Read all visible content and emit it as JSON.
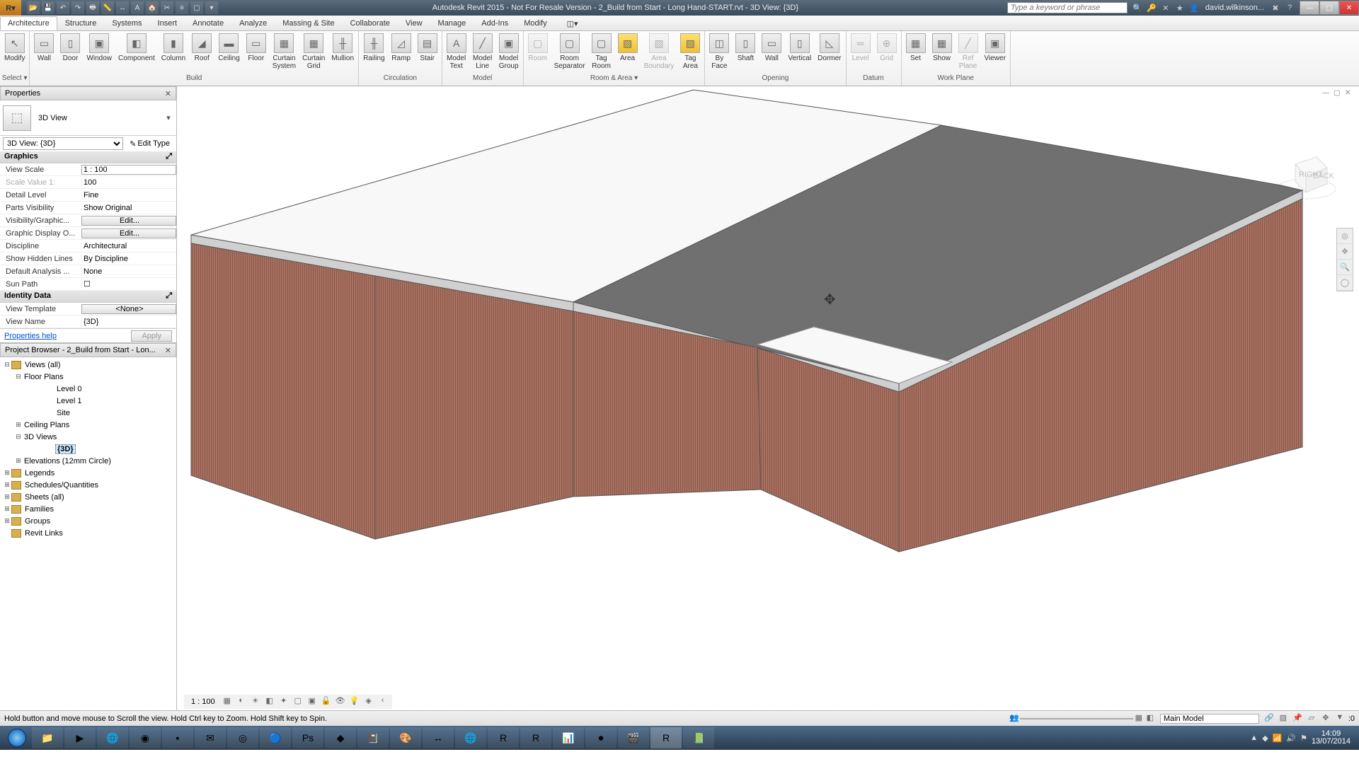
{
  "title": "Autodesk Revit 2015 - Not For Resale Version -     2_Build from Start - Long Hand-START.rvt - 3D View: {3D}",
  "search_placeholder": "Type a keyword or phrase",
  "user": "david.wilkinson...",
  "tabs": [
    "Architecture",
    "Structure",
    "Systems",
    "Insert",
    "Annotate",
    "Analyze",
    "Massing & Site",
    "Collaborate",
    "View",
    "Manage",
    "Add-Ins",
    "Modify"
  ],
  "active_tab": 0,
  "ribbon_groups": [
    {
      "label": "Select ▾",
      "btns": [
        {
          "l": "Modify",
          "i": "↖"
        }
      ]
    },
    {
      "label": "Build",
      "btns": [
        {
          "l": "Wall",
          "i": "▭"
        },
        {
          "l": "Door",
          "i": "▯"
        },
        {
          "l": "Window",
          "i": "▣"
        },
        {
          "l": "Component",
          "i": "◧"
        },
        {
          "l": "Column",
          "i": "▮"
        },
        {
          "l": "Roof",
          "i": "◢"
        },
        {
          "l": "Ceiling",
          "i": "▬"
        },
        {
          "l": "Floor",
          "i": "▭"
        },
        {
          "l": "Curtain\nSystem",
          "i": "▦"
        },
        {
          "l": "Curtain\nGrid",
          "i": "▦"
        },
        {
          "l": "Mullion",
          "i": "╫"
        }
      ]
    },
    {
      "label": "Circulation",
      "btns": [
        {
          "l": "Railing",
          "i": "╫"
        },
        {
          "l": "Ramp",
          "i": "◿"
        },
        {
          "l": "Stair",
          "i": "▤"
        }
      ]
    },
    {
      "label": "Model",
      "btns": [
        {
          "l": "Model\nText",
          "i": "A"
        },
        {
          "l": "Model\nLine",
          "i": "╱"
        },
        {
          "l": "Model\nGroup",
          "i": "▣"
        }
      ]
    },
    {
      "label": "Room & Area ▾",
      "btns": [
        {
          "l": "Room",
          "i": "▢",
          "dim": true
        },
        {
          "l": "Room\nSeparator",
          "i": "▢"
        },
        {
          "l": "Tag\nRoom",
          "i": "▢"
        },
        {
          "l": "Area",
          "i": "▨",
          "y": true
        },
        {
          "l": "Area\nBoundary",
          "i": "▨",
          "dim": true
        },
        {
          "l": "Tag\nArea",
          "i": "▨",
          "y": true
        }
      ]
    },
    {
      "label": "Opening",
      "btns": [
        {
          "l": "By\nFace",
          "i": "◫"
        },
        {
          "l": "Shaft",
          "i": "▯"
        },
        {
          "l": "Wall",
          "i": "▭"
        },
        {
          "l": "Vertical",
          "i": "▯"
        },
        {
          "l": "Dormer",
          "i": "◺"
        }
      ]
    },
    {
      "label": "Datum",
      "btns": [
        {
          "l": "Level",
          "i": "═",
          "dim": true
        },
        {
          "l": "Grid",
          "i": "⊕",
          "dim": true
        }
      ]
    },
    {
      "label": "Work Plane",
      "btns": [
        {
          "l": "Set",
          "i": "▦"
        },
        {
          "l": "Show",
          "i": "▦"
        },
        {
          "l": "Ref\nPlane",
          "i": "╱",
          "dim": true
        },
        {
          "l": "Viewer",
          "i": "▣"
        }
      ]
    }
  ],
  "properties": {
    "header": "Properties",
    "type": "3D View",
    "instance": "3D View: {3D}",
    "edit_type": "Edit Type",
    "graphics_label": "Graphics",
    "rows_g": [
      {
        "n": "View Scale",
        "v": "1 : 100",
        "boxed": true
      },
      {
        "n": "Scale Value   1:",
        "v": "100",
        "dim": true
      },
      {
        "n": "Detail Level",
        "v": "Fine"
      },
      {
        "n": "Parts Visibility",
        "v": "Show Original"
      },
      {
        "n": "Visibility/Graphic...",
        "v": "Edit...",
        "btn": true
      },
      {
        "n": "Graphic Display O...",
        "v": "Edit...",
        "btn": true
      },
      {
        "n": "Discipline",
        "v": "Architectural"
      },
      {
        "n": "Show Hidden Lines",
        "v": "By Discipline"
      },
      {
        "n": "Default Analysis ...",
        "v": "None"
      },
      {
        "n": "Sun Path",
        "v": "☐"
      }
    ],
    "identity_label": "Identity Data",
    "rows_i": [
      {
        "n": "View Template",
        "v": "<None>",
        "btn": true
      },
      {
        "n": "View Name",
        "v": "{3D}"
      }
    ],
    "help": "Properties help",
    "apply": "Apply"
  },
  "browser": {
    "header": "Project Browser - 2_Build from Start - Lon...",
    "nodes": [
      {
        "lvl": 0,
        "t": "⊟",
        "ic": true,
        "l": "Views (all)"
      },
      {
        "lvl": 1,
        "t": "⊟",
        "l": "Floor Plans"
      },
      {
        "lvl": 3,
        "l": "Level 0"
      },
      {
        "lvl": 3,
        "l": "Level 1"
      },
      {
        "lvl": 3,
        "l": "Site"
      },
      {
        "lvl": 1,
        "t": "⊞",
        "l": "Ceiling Plans"
      },
      {
        "lvl": 1,
        "t": "⊟",
        "l": "3D Views"
      },
      {
        "lvl": 3,
        "l": "{3D}",
        "sel": true
      },
      {
        "lvl": 1,
        "t": "⊞",
        "l": "Elevations (12mm Circle)"
      },
      {
        "lvl": 0,
        "t": "⊞",
        "ic": true,
        "l": "Legends"
      },
      {
        "lvl": 0,
        "t": "⊞",
        "ic": true,
        "l": "Schedules/Quantities"
      },
      {
        "lvl": 0,
        "t": "⊞",
        "ic": true,
        "l": "Sheets (all)"
      },
      {
        "lvl": 0,
        "t": "⊞",
        "ic": true,
        "l": "Families"
      },
      {
        "lvl": 0,
        "t": "⊞",
        "ic": true,
        "l": "Groups"
      },
      {
        "lvl": 0,
        "t": " ",
        "ic": true,
        "l": "Revit Links"
      }
    ]
  },
  "vcb_scale": "1 : 100",
  "status_text": "Hold button and move mouse to Scroll the view. Hold Ctrl key to Zoom. Hold Shift key to Spin.",
  "design_option": "Main Model",
  "clock": {
    "time": "14:09",
    "date": "13/07/2014"
  }
}
